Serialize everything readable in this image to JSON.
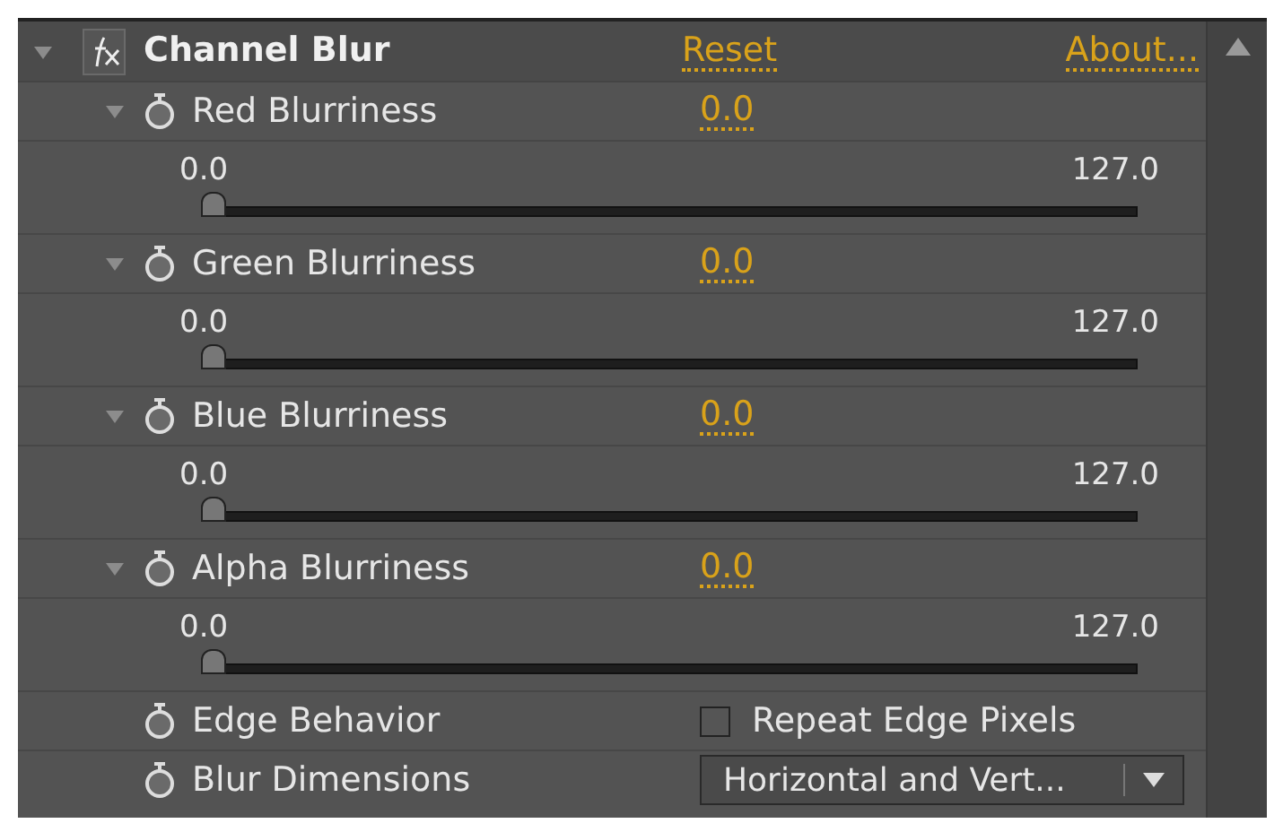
{
  "effect": {
    "name": "Channel Blur",
    "expanded": true,
    "reset": "Reset",
    "about": "About..."
  },
  "params": [
    {
      "kind": "slider",
      "name": "Red Blurriness",
      "expanded": true,
      "value": "0.0",
      "min": "0.0",
      "max": "127.0",
      "level": 0
    },
    {
      "kind": "slider",
      "name": "Green Blurriness",
      "expanded": true,
      "value": "0.0",
      "min": "0.0",
      "max": "127.0",
      "level": 0
    },
    {
      "kind": "slider",
      "name": "Blue Blurriness",
      "expanded": true,
      "value": "0.0",
      "min": "0.0",
      "max": "127.0",
      "level": 0
    },
    {
      "kind": "slider",
      "name": "Alpha Blurriness",
      "expanded": true,
      "value": "0.0",
      "min": "0.0",
      "max": "127.0",
      "level": 0
    },
    {
      "kind": "checkbox",
      "name": "Edge Behavior",
      "label": "Repeat Edge Pixels",
      "checked": false
    },
    {
      "kind": "dropdown",
      "name": "Blur Dimensions",
      "value": "Horizontal and Vert..."
    }
  ]
}
